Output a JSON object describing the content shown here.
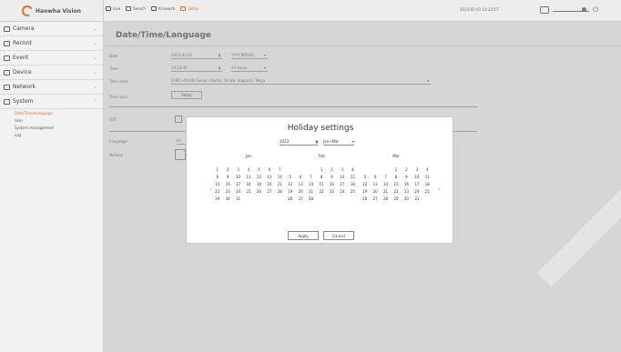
{
  "brand": {
    "name": "Hanwha Vision"
  },
  "topnav": [
    {
      "label": "Live",
      "icon": "monitor-icon",
      "accent": false
    },
    {
      "label": "Search",
      "icon": "search-icon",
      "accent": false
    },
    {
      "label": "AI search",
      "icon": "ai-search-icon",
      "accent": false
    },
    {
      "label": "Setup",
      "icon": "gear-icon",
      "accent": true
    }
  ],
  "clock": "2023-01-01 14:23:57",
  "colors": {
    "accent": "#e2711d"
  },
  "sidebar": {
    "items": [
      {
        "label": "Camera",
        "icon": "camera-icon"
      },
      {
        "label": "Record",
        "icon": "record-icon"
      },
      {
        "label": "Event",
        "icon": "event-icon"
      },
      {
        "label": "Device",
        "icon": "device-icon"
      },
      {
        "label": "Network",
        "icon": "network-icon"
      },
      {
        "label": "System",
        "icon": "system-icon"
      }
    ],
    "subitems": [
      {
        "label": "Date/Time/Language",
        "active": true
      },
      {
        "label": "User",
        "active": false
      },
      {
        "label": "System management",
        "active": false
      },
      {
        "label": "Log",
        "active": false
      }
    ]
  },
  "main": {
    "title": "Date/Time/Language",
    "date_label": "Date",
    "date_value": "2023-01-01",
    "date_format": "YYYY-MM-DD",
    "time_label": "Time",
    "time_value": "14:23:45",
    "time_format": "24 hours",
    "timezone_label": "Time zone",
    "timezone_value": "(GMT+09:00) Seoul, Irkutsk, Osaka, Sapporo, Tokyo",
    "timesync_label": "Time sync.",
    "timesync_button": "Setup",
    "dst_label": "DST",
    "language_label": "Language",
    "language_value": "En",
    "holiday_label": "Holiday"
  },
  "dialog": {
    "title": "Holiday settings",
    "year": "2023",
    "range": "Jan~Mar",
    "months": [
      {
        "name": "Jan",
        "offset": 0,
        "days": [
          "1",
          "2",
          "3",
          "4",
          "5",
          "6",
          "7",
          "8",
          "9",
          "10",
          "11",
          "12",
          "13",
          "14",
          "15",
          "16",
          "17",
          "18",
          "19",
          "20",
          "21",
          "22",
          "23",
          "24",
          "25",
          "26",
          "27",
          "28",
          "29",
          "30",
          "31"
        ]
      },
      {
        "name": "Feb",
        "offset": 3,
        "days": [
          "1",
          "2",
          "3",
          "4",
          "5",
          "6",
          "7",
          "8",
          "9",
          "10",
          "11",
          "12",
          "13",
          "14",
          "15",
          "16",
          "17",
          "18",
          "19",
          "20",
          "21",
          "22",
          "23",
          "24",
          "25",
          "26",
          "27",
          "28"
        ]
      },
      {
        "name": "Mar",
        "offset": 3,
        "days": [
          "1",
          "2",
          "3",
          "4",
          "5",
          "6",
          "7",
          "8",
          "9",
          "10",
          "11",
          "12",
          "13",
          "14",
          "15",
          "16",
          "17",
          "18",
          "19",
          "20",
          "21",
          "22",
          "23",
          "24",
          "25",
          "26",
          "27",
          "28",
          "29",
          "30",
          "31"
        ]
      }
    ],
    "apply": "Apply",
    "cancel": "Cancel"
  }
}
